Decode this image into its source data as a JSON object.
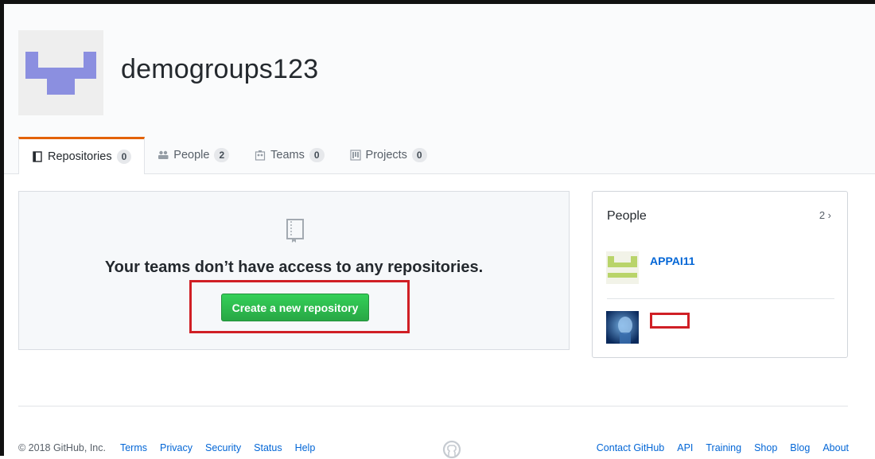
{
  "org": {
    "name": "demogroups123"
  },
  "tabs": [
    {
      "label": "Repositories",
      "count": "0",
      "icon": "repo-icon"
    },
    {
      "label": "People",
      "count": "2",
      "icon": "people-icon"
    },
    {
      "label": "Teams",
      "count": "0",
      "icon": "teams-icon"
    },
    {
      "label": "Projects",
      "count": "0",
      "icon": "project-icon"
    }
  ],
  "blankslate": {
    "icon": "repo-icon",
    "title": "Your teams don’t have access to any repositories.",
    "button_label": "Create a new repository"
  },
  "people_panel": {
    "title": "People",
    "count": "2 ›",
    "members": [
      {
        "name": "APPAI11"
      },
      {
        "name": ""
      }
    ]
  },
  "footer": {
    "copyright": "© 2018 GitHub, Inc.",
    "left_links": [
      "Terms",
      "Privacy",
      "Security",
      "Status",
      "Help"
    ],
    "right_links": [
      "Contact GitHub",
      "API",
      "Training",
      "Shop",
      "Blog",
      "About"
    ]
  },
  "colors": {
    "accent_tab": "#e36209",
    "button_green": "#28a745",
    "link_blue": "#0366d6",
    "annotation_red": "#d01f25"
  }
}
